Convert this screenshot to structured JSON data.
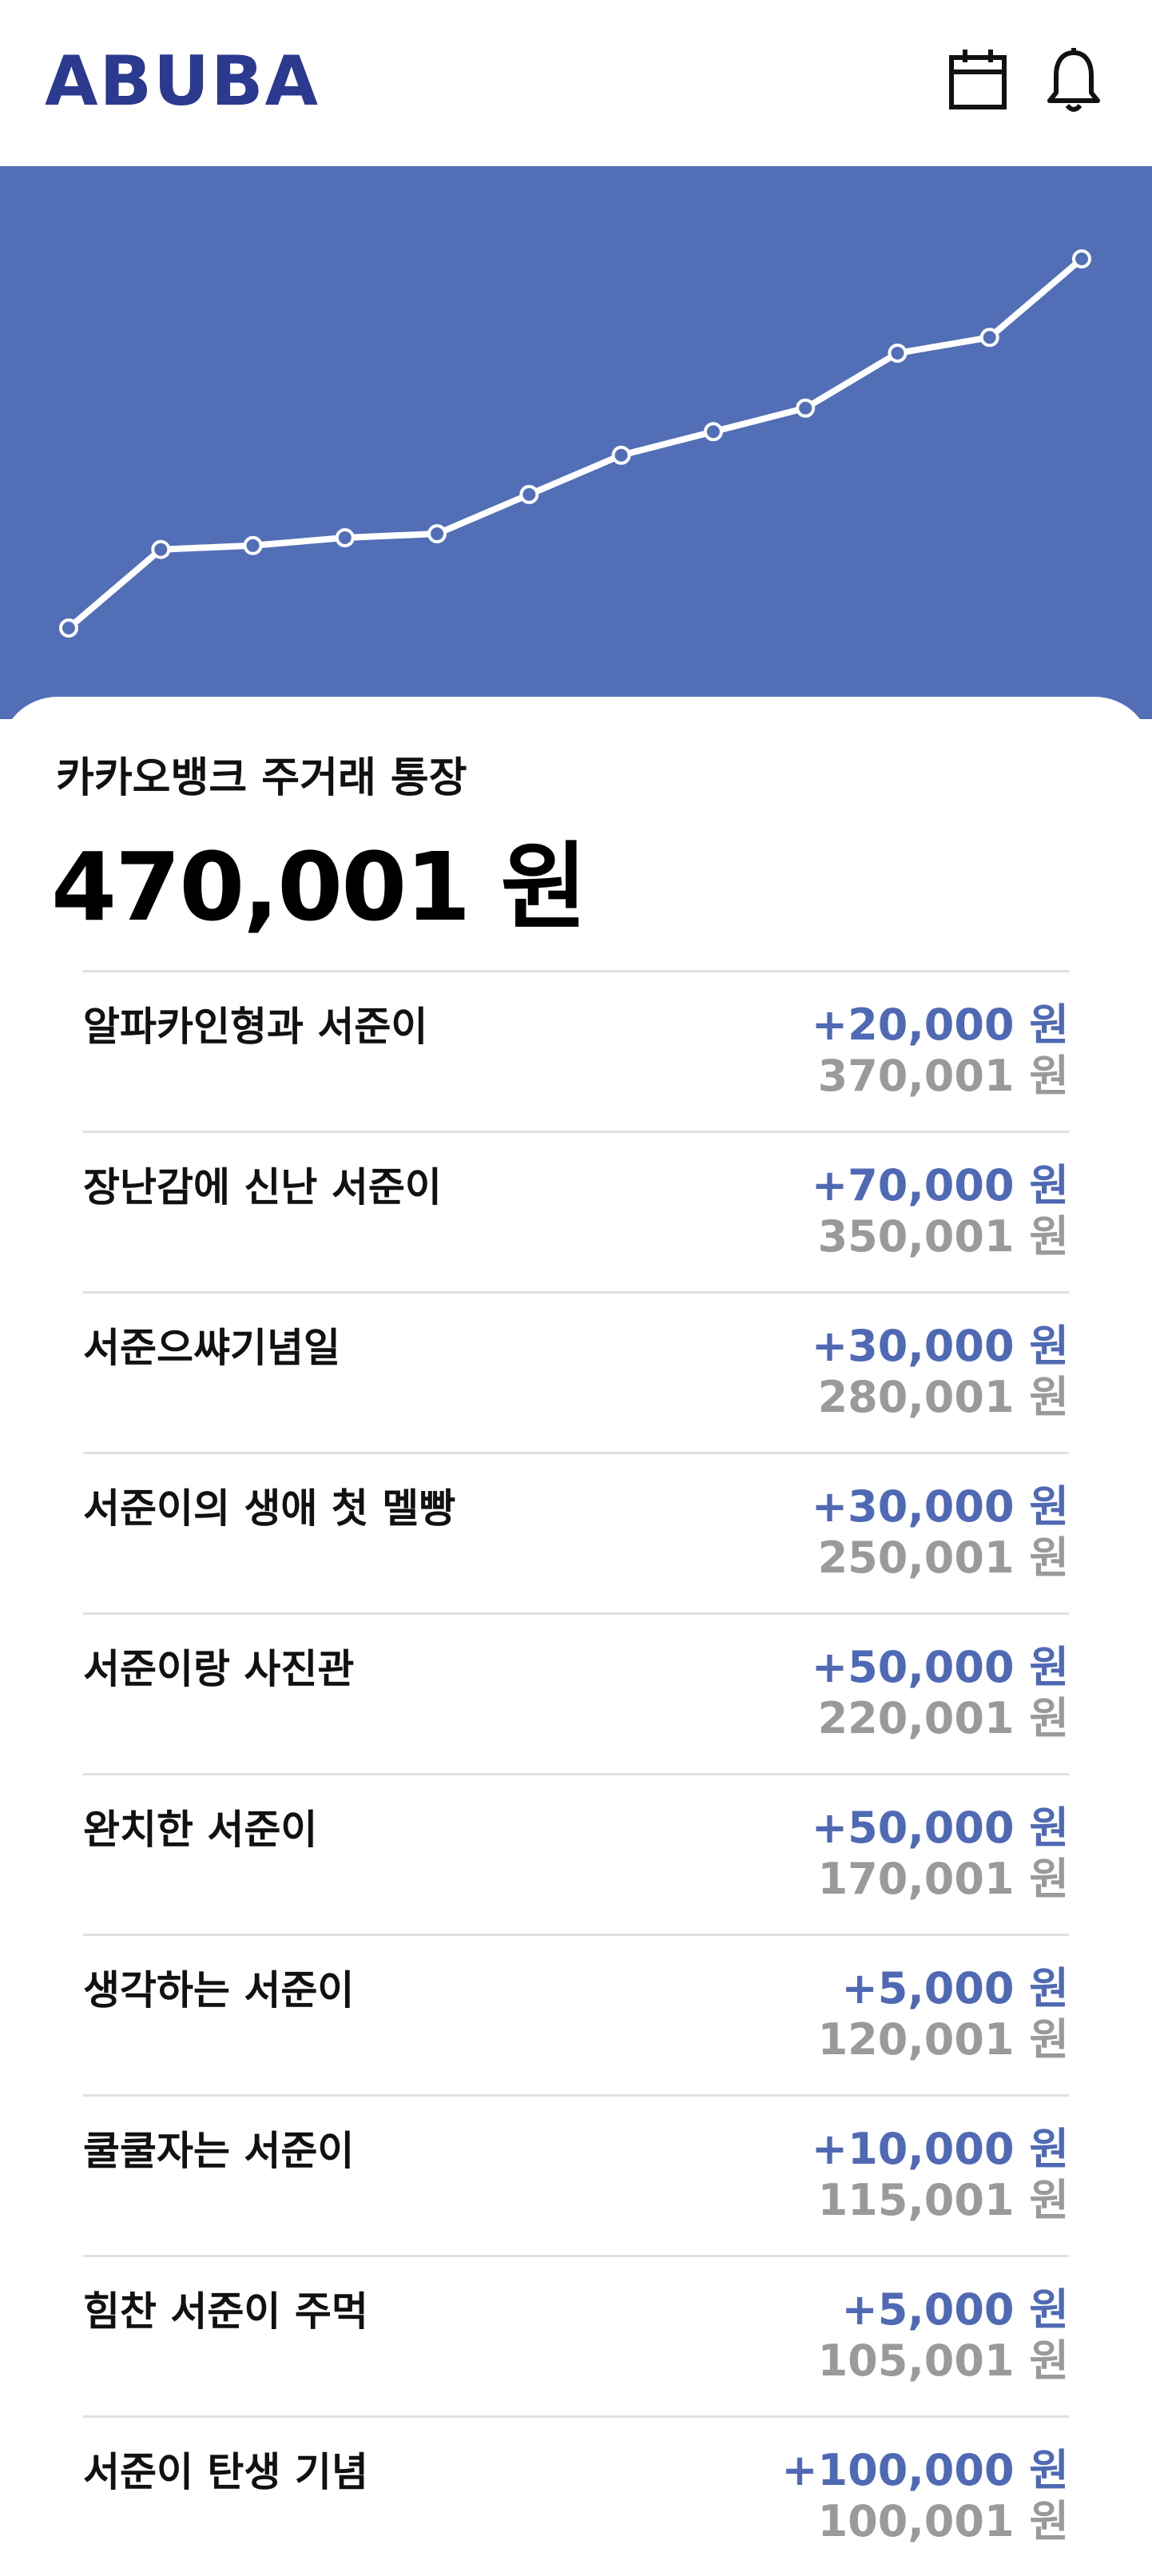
{
  "app": {
    "logo": "ABUBA",
    "icons": [
      "calendar-icon",
      "bell-icon"
    ]
  },
  "colors": {
    "brand": "#2b3a8f",
    "chart_bg": "#526eb6",
    "deposit": "#4f69b4",
    "balance_gray": "#9a9a9a"
  },
  "account": {
    "name": "카카오뱅크 주거래 통장",
    "balance": "470,001 원"
  },
  "chart_data": {
    "type": "line",
    "title": "",
    "xlabel": "",
    "ylabel": "",
    "grid": false,
    "series": [
      {
        "values": [
          100001,
          200001,
          205001,
          215001,
          220001,
          270001,
          320001,
          350001,
          380001,
          450001,
          470001,
          570001
        ]
      }
    ]
  },
  "transactions": [
    {
      "title": "알파카인형과 서준이",
      "amount": "+20,000 원",
      "balance": "370,001 원"
    },
    {
      "title": "장난감에 신난 서준이",
      "amount": "+70,000 원",
      "balance": "350,001 원"
    },
    {
      "title": "서준으쌰기념일",
      "amount": "+30,000 원",
      "balance": "280,001 원"
    },
    {
      "title": "서준이의 생애 첫 멜빵",
      "amount": "+30,000 원",
      "balance": "250,001 원"
    },
    {
      "title": "서준이랑 사진관",
      "amount": "+50,000 원",
      "balance": "220,001 원"
    },
    {
      "title": "완치한 서준이",
      "amount": "+50,000 원",
      "balance": "170,001 원"
    },
    {
      "title": "생각하는 서준이",
      "amount": "+5,000 원",
      "balance": "120,001 원"
    },
    {
      "title": "쿨쿨자는 서준이",
      "amount": "+10,000 원",
      "balance": "115,001 원"
    },
    {
      "title": "힘찬 서준이 주먹",
      "amount": "+5,000 원",
      "balance": "105,001 원"
    },
    {
      "title": "서준이 탄생 기념",
      "amount": "+100,000 원",
      "balance": "100,001 원"
    }
  ]
}
